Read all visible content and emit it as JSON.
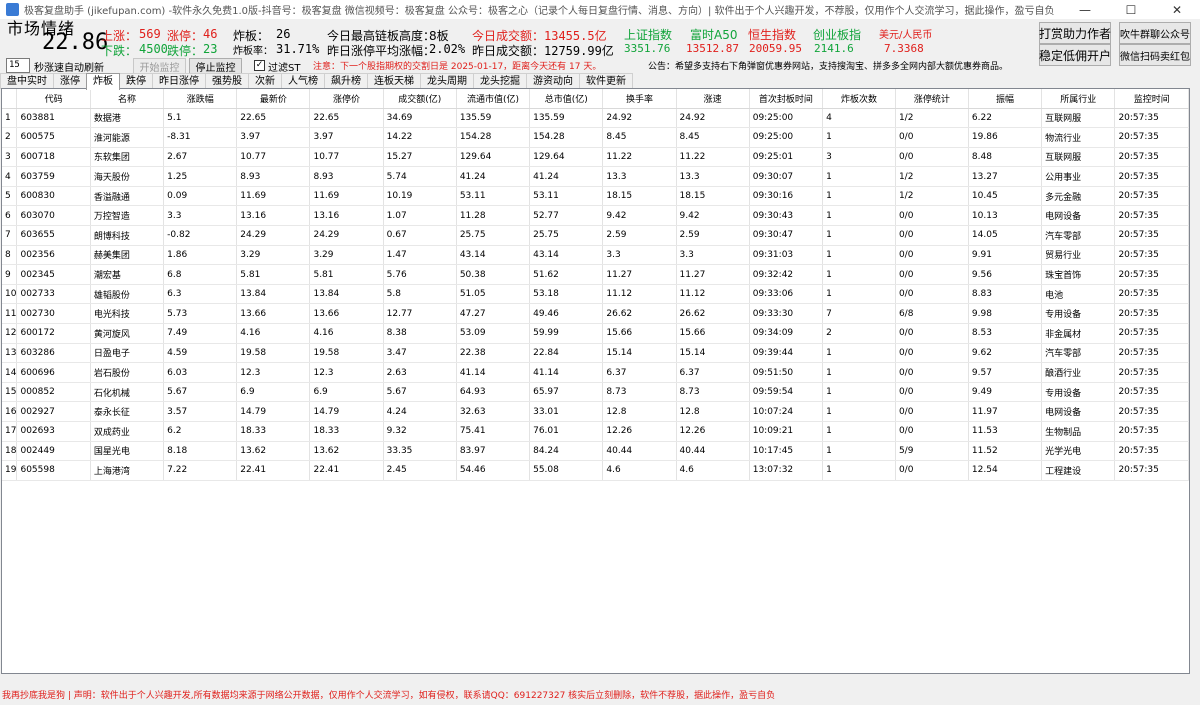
{
  "window": {
    "title": "极客复盘助手 (jikefupan.com) -软件永久免费1.0版-抖音号：极客复盘 微信视频号：极客复盘 公众号：极客之心（记录个人每日复盘行情、消息、方向）| 软件出于个人兴趣开发，不荐股，仅用作个人交流学习，据此操作，盈亏自负",
    "minimize": "—",
    "maximize": "☐",
    "close": "✕"
  },
  "market": {
    "label": "市场情绪",
    "value": "22.86",
    "up_label": "上涨：",
    "up_value": "569",
    "limit_up_label": "涨停：",
    "limit_up_value": "46",
    "down_label": "下跌：",
    "down_value": "4500",
    "limit_down_label": "跌停：",
    "limit_down_value": "23",
    "broken_label": "炸板：",
    "broken_value": "26",
    "broken_rate_label": "炸板率：",
    "broken_rate_value": "31.71%",
    "max_board_label": "今日最高链板高度：",
    "max_board_value": "8板",
    "avg_limit_label": "昨日涨停平均涨幅：",
    "avg_limit_value": "2.02%",
    "turnover_today_label": "今日成交额：",
    "turnover_today_value": "13455.5亿",
    "turnover_yday_label": "昨日成交额：",
    "turnover_yday_value": "12759.99亿"
  },
  "indices": [
    {
      "name": "上证指数",
      "value": "3351.76",
      "name_color": "#11a43a",
      "value_color": "#11a43a"
    },
    {
      "name": "富时A50",
      "value": "13512.87",
      "name_color": "#11a43a",
      "value_color": "#e0201c"
    },
    {
      "name": "恒生指数",
      "value": "20059.95",
      "name_color": "#e0201c",
      "value_color": "#e0201c"
    },
    {
      "name": "创业板指",
      "value": "2141.6",
      "name_color": "#11a43a",
      "value_color": "#11a43a"
    },
    {
      "name": "美元/人民币",
      "value": "7.3368",
      "name_color": "#e0201c",
      "value_color": "#e0201c"
    }
  ],
  "buttons": {
    "donate": "打赏助力作者",
    "open_account": "稳定低佣开户",
    "public_account": "吹牛群聊公众号",
    "wechat_red": "微信扫码卖红包"
  },
  "controls": {
    "refresh_seconds": "15",
    "refresh_label": "秒涨速自动刷新",
    "start": "开始监控",
    "stop": "停止监控",
    "filter_st": "过滤ST",
    "checked": "✓",
    "notice": "注意：下一个股指期权的交割日是 2025-01-17，距离今天还有 17 天。",
    "announcement": "公告：希望多支持右下角弹窗优惠券网站，支持搜淘宝、拼多多全网内部大额优惠券商品。"
  },
  "tabs": [
    "盘中实时",
    "涨停",
    "炸板",
    "跌停",
    "昨日涨停",
    "强势股",
    "次新",
    "人气榜",
    "飙升榜",
    "连板天梯",
    "龙头周期",
    "龙头挖掘",
    "游资动向",
    "软件更新"
  ],
  "active_tab": 2,
  "table": {
    "columns": [
      "",
      "代码",
      "名称",
      "涨跌幅",
      "最新价",
      "涨停价",
      "成交额(亿)",
      "流通市值(亿)",
      "总市值(亿)",
      "换手率",
      "涨速",
      "首次封板时间",
      "炸板次数",
      "涨停统计",
      "振幅",
      "所属行业",
      "监控时间"
    ],
    "rows": [
      [
        "1",
        "603881",
        "数据港",
        "5.1",
        "22.65",
        "22.65",
        "34.69",
        "135.59",
        "135.59",
        "24.92",
        "24.92",
        "09:25:00",
        "4",
        "1/2",
        "6.22",
        "互联网服",
        "20:57:35"
      ],
      [
        "2",
        "600575",
        "淮河能源",
        "-8.31",
        "3.97",
        "3.97",
        "14.22",
        "154.28",
        "154.28",
        "8.45",
        "8.45",
        "09:25:00",
        "1",
        "0/0",
        "19.86",
        "物流行业",
        "20:57:35"
      ],
      [
        "3",
        "600718",
        "东软集团",
        "2.67",
        "10.77",
        "10.77",
        "15.27",
        "129.64",
        "129.64",
        "11.22",
        "11.22",
        "09:25:01",
        "3",
        "0/0",
        "8.48",
        "互联网服",
        "20:57:35"
      ],
      [
        "4",
        "603759",
        "海天股份",
        "1.25",
        "8.93",
        "8.93",
        "5.74",
        "41.24",
        "41.24",
        "13.3",
        "13.3",
        "09:30:07",
        "1",
        "1/2",
        "13.27",
        "公用事业",
        "20:57:35"
      ],
      [
        "5",
        "600830",
        "香溢融通",
        "0.09",
        "11.69",
        "11.69",
        "10.19",
        "53.11",
        "53.11",
        "18.15",
        "18.15",
        "09:30:16",
        "1",
        "1/2",
        "10.45",
        "多元金融",
        "20:57:35"
      ],
      [
        "6",
        "603070",
        "万控智造",
        "3.3",
        "13.16",
        "13.16",
        "1.07",
        "11.28",
        "52.77",
        "9.42",
        "9.42",
        "09:30:43",
        "1",
        "0/0",
        "10.13",
        "电网设备",
        "20:57:35"
      ],
      [
        "7",
        "603655",
        "朗博科技",
        "-0.82",
        "24.29",
        "24.29",
        "0.67",
        "25.75",
        "25.75",
        "2.59",
        "2.59",
        "09:30:47",
        "1",
        "0/0",
        "14.05",
        "汽车零部",
        "20:57:35"
      ],
      [
        "8",
        "002356",
        "赫美集团",
        "1.86",
        "3.29",
        "3.29",
        "1.47",
        "43.14",
        "43.14",
        "3.3",
        "3.3",
        "09:31:03",
        "1",
        "0/0",
        "9.91",
        "贸易行业",
        "20:57:35"
      ],
      [
        "9",
        "002345",
        "潮宏基",
        "6.8",
        "5.81",
        "5.81",
        "5.76",
        "50.38",
        "51.62",
        "11.27",
        "11.27",
        "09:32:42",
        "1",
        "0/0",
        "9.56",
        "珠宝首饰",
        "20:57:35"
      ],
      [
        "10",
        "002733",
        "雄韬股份",
        "6.3",
        "13.84",
        "13.84",
        "5.8",
        "51.05",
        "53.18",
        "11.12",
        "11.12",
        "09:33:06",
        "1",
        "0/0",
        "8.83",
        "电池",
        "20:57:35"
      ],
      [
        "11",
        "002730",
        "电光科技",
        "5.73",
        "13.66",
        "13.66",
        "12.77",
        "47.27",
        "49.46",
        "26.62",
        "26.62",
        "09:33:30",
        "7",
        "6/8",
        "9.98",
        "专用设备",
        "20:57:35"
      ],
      [
        "12",
        "600172",
        "黄河旋风",
        "7.49",
        "4.16",
        "4.16",
        "8.38",
        "53.09",
        "59.99",
        "15.66",
        "15.66",
        "09:34:09",
        "2",
        "0/0",
        "8.53",
        "非金属材",
        "20:57:35"
      ],
      [
        "13",
        "603286",
        "日盈电子",
        "4.59",
        "19.58",
        "19.58",
        "3.47",
        "22.38",
        "22.84",
        "15.14",
        "15.14",
        "09:39:44",
        "1",
        "0/0",
        "9.62",
        "汽车零部",
        "20:57:35"
      ],
      [
        "14",
        "600696",
        "岩石股份",
        "6.03",
        "12.3",
        "12.3",
        "2.63",
        "41.14",
        "41.14",
        "6.37",
        "6.37",
        "09:51:50",
        "1",
        "0/0",
        "9.57",
        "酿酒行业",
        "20:57:35"
      ],
      [
        "15",
        "000852",
        "石化机械",
        "5.67",
        "6.9",
        "6.9",
        "5.67",
        "64.93",
        "65.97",
        "8.73",
        "8.73",
        "09:59:54",
        "1",
        "0/0",
        "9.49",
        "专用设备",
        "20:57:35"
      ],
      [
        "16",
        "002927",
        "泰永长征",
        "3.57",
        "14.79",
        "14.79",
        "4.24",
        "32.63",
        "33.01",
        "12.8",
        "12.8",
        "10:07:24",
        "1",
        "0/0",
        "11.97",
        "电网设备",
        "20:57:35"
      ],
      [
        "17",
        "002693",
        "双成药业",
        "6.2",
        "18.33",
        "18.33",
        "9.32",
        "75.41",
        "76.01",
        "12.26",
        "12.26",
        "10:09:21",
        "1",
        "0/0",
        "11.53",
        "生物制品",
        "20:57:35"
      ],
      [
        "18",
        "002449",
        "国星光电",
        "8.18",
        "13.62",
        "13.62",
        "33.35",
        "83.97",
        "84.24",
        "40.44",
        "40.44",
        "10:17:45",
        "1",
        "5/9",
        "11.52",
        "光学光电",
        "20:57:35"
      ],
      [
        "19",
        "605598",
        "上海港湾",
        "7.22",
        "22.41",
        "22.41",
        "2.45",
        "54.46",
        "55.08",
        "4.6",
        "4.6",
        "13:07:32",
        "1",
        "0/0",
        "12.54",
        "工程建设",
        "20:57:35"
      ]
    ]
  },
  "footer": "我再抄底我是狗 | 声明：软件出于个人兴趣开发,所有数据均来源于网络公开数据，仅用作个人交流学习，如有侵权，联系请QQ：691227327 核实后立刻删除，软件不荐股，据此操作，盈亏自负"
}
